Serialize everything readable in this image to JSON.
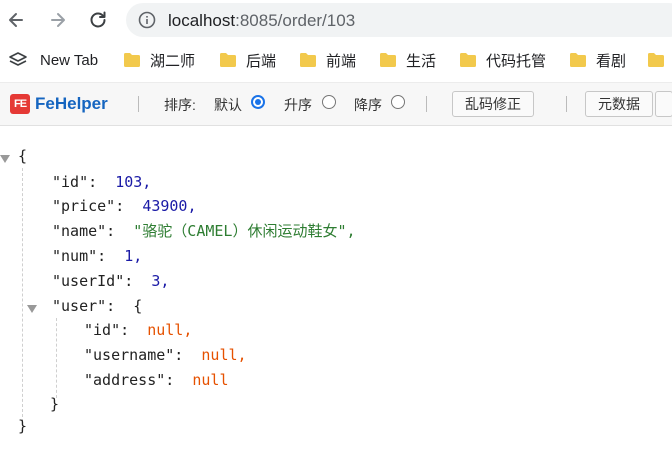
{
  "browser": {
    "url_host": "localhost",
    "url_path": ":8085/order/103"
  },
  "bookmarks": {
    "items": [
      {
        "label": "New Tab",
        "icon": "apps-icon"
      },
      {
        "label": "湖二师",
        "icon": "folder-icon"
      },
      {
        "label": "后端",
        "icon": "folder-icon"
      },
      {
        "label": "前端",
        "icon": "folder-icon"
      },
      {
        "label": "生活",
        "icon": "folder-icon"
      },
      {
        "label": "代码托管",
        "icon": "folder-icon"
      },
      {
        "label": "看剧",
        "icon": "folder-icon"
      },
      {
        "label": "",
        "icon": "folder-icon"
      }
    ]
  },
  "fehelper": {
    "logo_mark": "FE",
    "logo_text": "FeHelper",
    "sort_label": "排序:",
    "sort_default": "默认",
    "sort_asc": "升序",
    "sort_desc": "降序",
    "selected_sort": "默认",
    "fix_button": "乱码修正",
    "meta_button": "元数据"
  },
  "json": {
    "open_brace": "{",
    "close_brace": "}",
    "id_key": "\"id\":",
    "id_val": "103,",
    "price_key": "\"price\":",
    "price_val": "43900,",
    "name_key": "\"name\":",
    "name_val": "\"骆驼（CAMEL）休闲运动鞋女\",",
    "num_key": "\"num\":",
    "num_val": "1,",
    "userId_key": "\"userId\":",
    "userId_val": "3,",
    "user_key": "\"user\":",
    "user_open": "{",
    "user_close": "}",
    "u_id_key": "\"id\":",
    "u_id_val": "null,",
    "u_username_key": "\"username\":",
    "u_username_val": "null,",
    "u_address_key": "\"address\":",
    "u_address_val": "null"
  },
  "colors": {
    "accent": "#1a73e8",
    "string": "#2e7d32",
    "number": "#1a1aa6",
    "null": "#e65100",
    "fehelper_brand": "#e53935"
  }
}
